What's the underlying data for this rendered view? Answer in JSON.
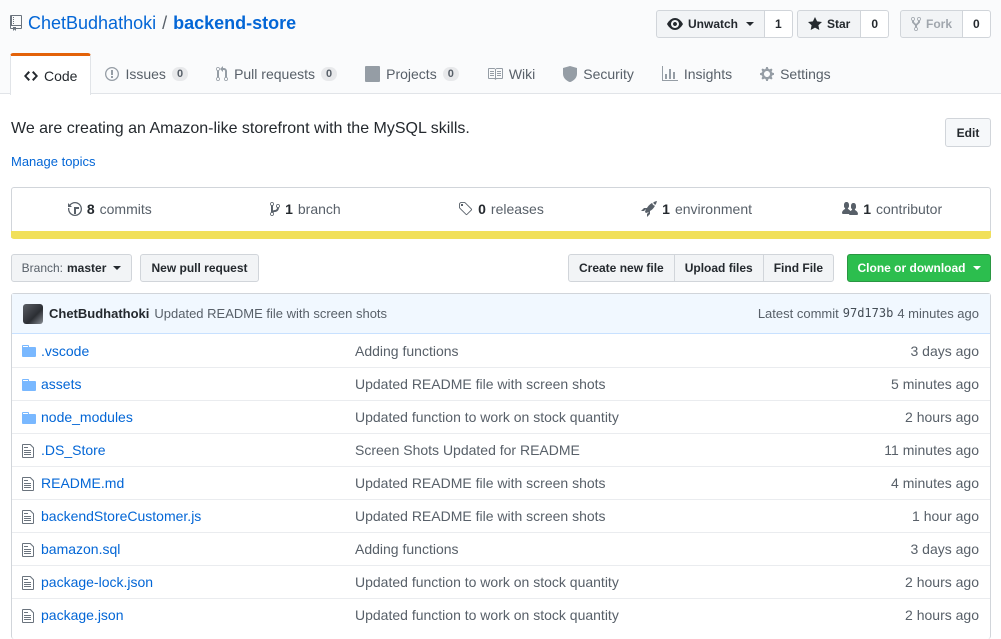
{
  "repo": {
    "owner": "ChetBudhathoki",
    "separator": "/",
    "name": "backend-store"
  },
  "actions": {
    "watch": {
      "label": "Unwatch",
      "count": "1"
    },
    "star": {
      "label": "Star",
      "count": "0"
    },
    "fork": {
      "label": "Fork",
      "count": "0"
    }
  },
  "tabs": [
    {
      "label": "Code",
      "icon": "code-icon"
    },
    {
      "label": "Issues",
      "count": "0",
      "icon": "issue-icon"
    },
    {
      "label": "Pull requests",
      "count": "0",
      "icon": "pull-request-icon"
    },
    {
      "label": "Projects",
      "count": "0",
      "icon": "project-icon"
    },
    {
      "label": "Wiki",
      "icon": "book-icon"
    },
    {
      "label": "Security",
      "icon": "shield-icon"
    },
    {
      "label": "Insights",
      "icon": "graph-icon"
    },
    {
      "label": "Settings",
      "icon": "gear-icon"
    }
  ],
  "description": "We are creating an Amazon-like storefront with the MySQL skills.",
  "manage_topics": "Manage topics",
  "edit_label": "Edit",
  "summary": {
    "commits": {
      "count": "8",
      "label": "commits"
    },
    "branches": {
      "count": "1",
      "label": "branch"
    },
    "releases": {
      "count": "0",
      "label": "releases"
    },
    "environments": {
      "count": "1",
      "label": "environment"
    },
    "contributors": {
      "count": "1",
      "label": "contributor"
    },
    "language_color": "#f1e05a"
  },
  "toolbar": {
    "branch_prefix": "Branch:",
    "branch_name": "master",
    "new_pr": "New pull request",
    "create_file": "Create new file",
    "upload_files": "Upload files",
    "find_file": "Find File",
    "clone": "Clone or download"
  },
  "latest_commit": {
    "author": "ChetBudhathoki",
    "message": "Updated README file with screen shots",
    "prefix": "Latest commit",
    "sha": "97d173b",
    "age": "4 minutes ago"
  },
  "files": [
    {
      "name": ".vscode",
      "type": "folder",
      "message": "Adding functions",
      "age": "3 days ago"
    },
    {
      "name": "assets",
      "type": "folder",
      "message": "Updated README file with screen shots",
      "age": "5 minutes ago"
    },
    {
      "name": "node_modules",
      "type": "folder",
      "message": "Updated function to work on stock quantity",
      "age": "2 hours ago"
    },
    {
      "name": ".DS_Store",
      "type": "file",
      "message": "Screen Shots Updated for README",
      "age": "11 minutes ago"
    },
    {
      "name": "README.md",
      "type": "file",
      "message": "Updated README file with screen shots",
      "age": "4 minutes ago"
    },
    {
      "name": "backendStoreCustomer.js",
      "type": "file",
      "message": "Updated README file with screen shots",
      "age": "1 hour ago"
    },
    {
      "name": "bamazon.sql",
      "type": "file",
      "message": "Adding functions",
      "age": "3 days ago"
    },
    {
      "name": "package-lock.json",
      "type": "file",
      "message": "Updated function to work on stock quantity",
      "age": "2 hours ago"
    },
    {
      "name": "package.json",
      "type": "file",
      "message": "Updated function to work on stock quantity",
      "age": "2 hours ago"
    }
  ]
}
